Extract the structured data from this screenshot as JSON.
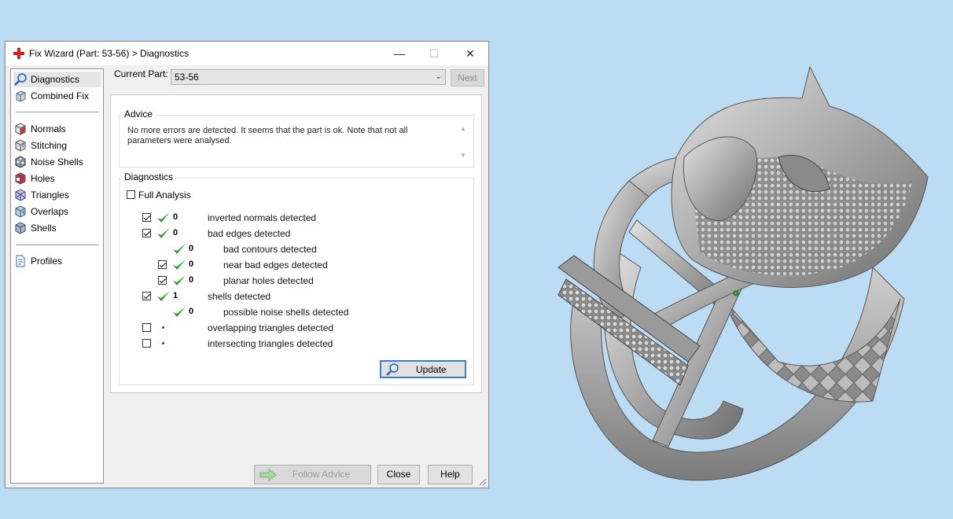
{
  "dialog": {
    "title": "Fix Wizard (Part: 53-56) > Diagnostics",
    "window_buttons": {
      "minimize": "—",
      "maximize": "☐",
      "close": "✕"
    }
  },
  "nav": {
    "items": [
      {
        "label": "Diagnostics",
        "icon": "magnifier-icon",
        "selected": true
      },
      {
        "label": "Combined Fix",
        "icon": "cube-stack-icon"
      },
      {
        "label": "Normals",
        "icon": "cube-red-icon"
      },
      {
        "label": "Stitching",
        "icon": "cube-stitch-icon"
      },
      {
        "label": "Noise Shells",
        "icon": "cube-noise-icon"
      },
      {
        "label": "Holes",
        "icon": "cube-hole-icon"
      },
      {
        "label": "Triangles",
        "icon": "cube-triangles-icon"
      },
      {
        "label": "Overlaps",
        "icon": "cube-overlap-icon"
      },
      {
        "label": "Shells",
        "icon": "cube-shells-icon"
      },
      {
        "label": "Profiles",
        "icon": "document-icon"
      }
    ]
  },
  "current_part": {
    "label": "Current Part:",
    "value": "53-56"
  },
  "next_button": "Next",
  "advice": {
    "group_label": "Advice",
    "line1": "No more errors are detected. It seems that the part is ok. Note that not all",
    "line2": "parameters were analysed."
  },
  "diagnostics": {
    "group_label": "Diagnostics",
    "full_analysis": {
      "label": "Full Analysis",
      "checked": false
    },
    "rows": [
      {
        "label": "inverted normals detected",
        "count": "0",
        "checked": true,
        "status": "ok"
      },
      {
        "label": "bad edges detected",
        "count": "0",
        "checked": true,
        "status": "ok"
      },
      {
        "label": "bad contours detected",
        "count": "0",
        "status": "ok"
      },
      {
        "label": "near bad edges detected",
        "count": "0",
        "checked": true,
        "status": "ok"
      },
      {
        "label": "planar holes detected",
        "count": "0",
        "checked": true,
        "status": "ok"
      },
      {
        "label": "shells detected",
        "count": "1",
        "checked": true,
        "status": "ok"
      },
      {
        "label": "possible noise shells detected",
        "count": "0",
        "status": "ok"
      },
      {
        "label": "overlapping triangles detected",
        "count": "",
        "checked": false,
        "status": "pending"
      },
      {
        "label": "intersecting triangles detected",
        "count": "",
        "checked": false,
        "status": "pending"
      }
    ]
  },
  "buttons": {
    "update": "Update",
    "follow_advice": "Follow Advice",
    "close": "Close",
    "help": "Help"
  },
  "colors": {
    "desktop": "#bcdcf4",
    "accent": "#3b7ed0",
    "ok_check": "#2e9a2e",
    "model": "#a8a8a8"
  }
}
